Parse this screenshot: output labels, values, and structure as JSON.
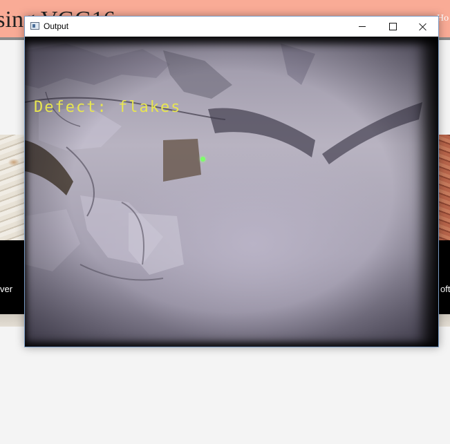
{
  "background_page": {
    "title": "s Using VGG16",
    "nav_item": "Ho",
    "card_left_caption": "ver",
    "card_right_caption": "oft"
  },
  "window": {
    "title": "Output",
    "controls": {
      "minimize": "minimize",
      "maximize": "maximize",
      "close": "close"
    }
  },
  "overlay": {
    "defect_text": "Defect: flakes"
  },
  "colors": {
    "header_bg": "#f9ab96",
    "label_color": "#e8e650",
    "marker_color": "#7dff6a",
    "window_border": "#7a9cc6"
  },
  "icons": {
    "app": "app-window-icon",
    "minimize": "minimize-icon",
    "maximize": "maximize-icon",
    "close": "close-icon"
  }
}
